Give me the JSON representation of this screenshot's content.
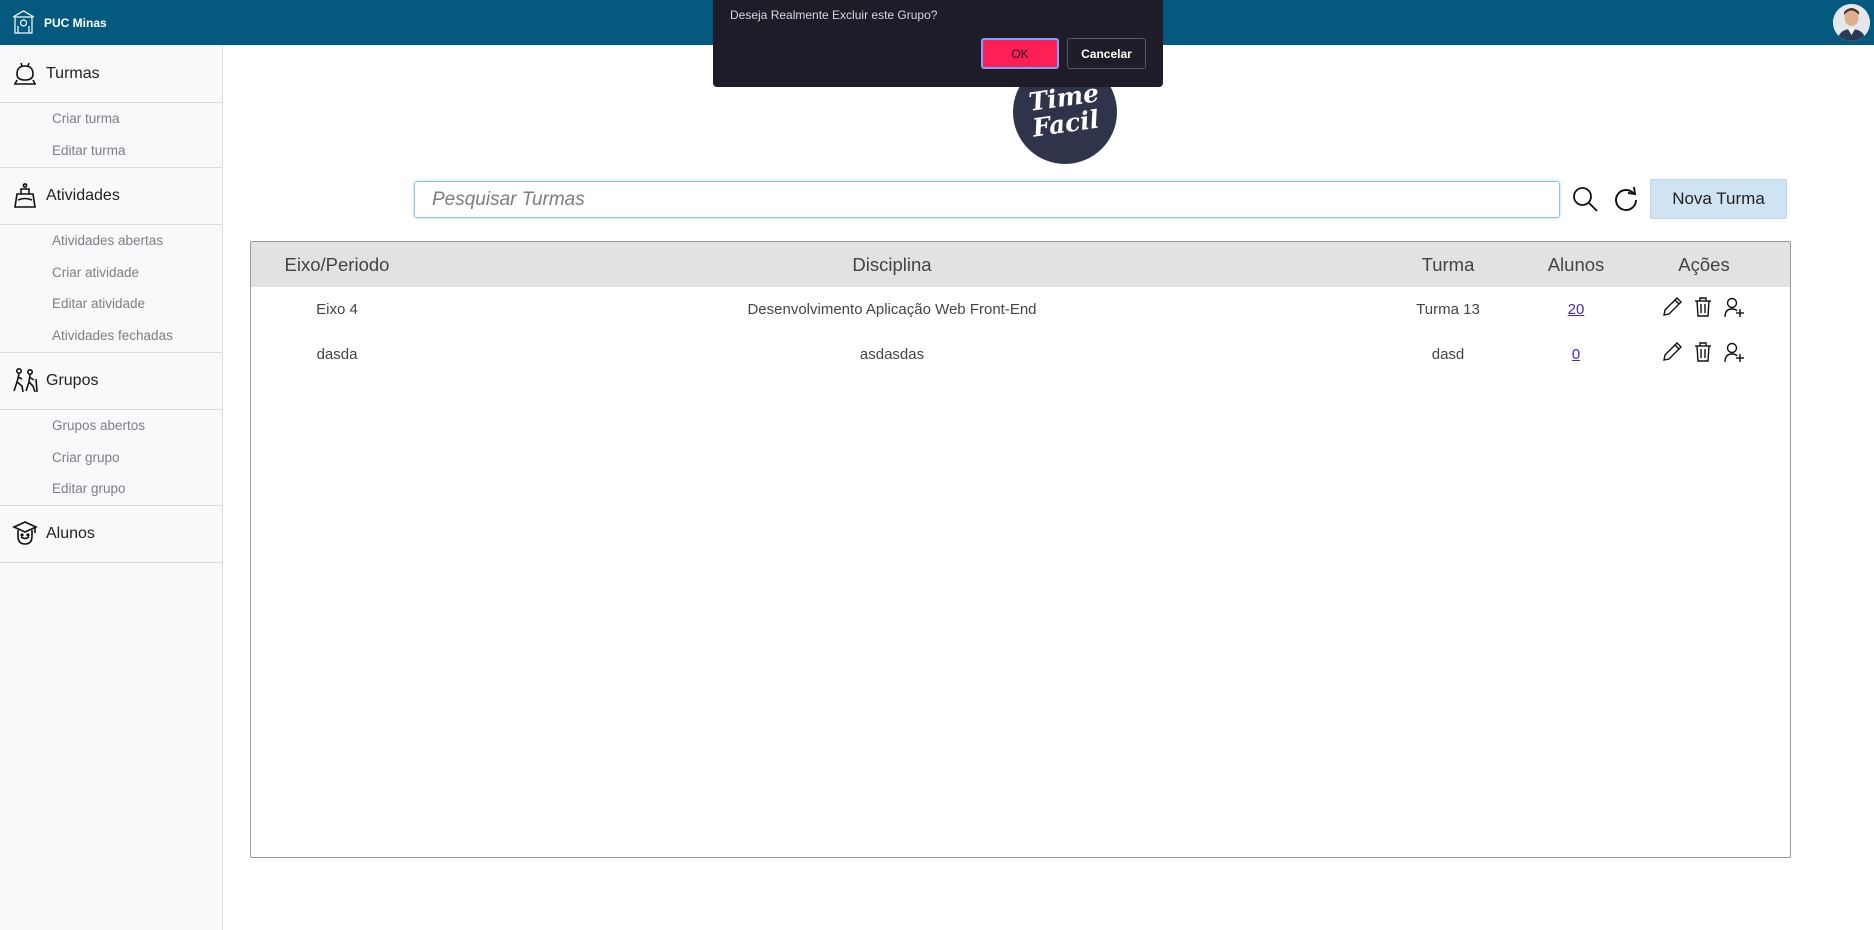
{
  "topbar": {
    "brand": "PUC Minas",
    "logo_icon": "puc-minas-crest-icon",
    "avatar_icon": "user-avatar-icon",
    "color": "#035a7e"
  },
  "sidebar": {
    "sections": [
      {
        "label": "Turmas",
        "icon": "class-icon",
        "items": [
          "Criar turma",
          "Editar turma"
        ]
      },
      {
        "label": "Atividades",
        "icon": "flask-icon",
        "items": [
          "Atividades abertas",
          "Criar atividade",
          "Editar atividade",
          "Atividades fechadas"
        ]
      },
      {
        "label": "Grupos",
        "icon": "group-hiking-icon",
        "items": [
          "Grupos abertos",
          "Criar grupo",
          "Editar grupo"
        ]
      },
      {
        "label": "Alunos",
        "icon": "student-icon",
        "items": []
      }
    ]
  },
  "app_logo": {
    "line1": "Time",
    "line2": "Facil"
  },
  "search": {
    "placeholder": "Pesquisar Turmas",
    "value": ""
  },
  "toolbar": {
    "search_icon": "search-icon",
    "refresh_icon": "refresh-icon",
    "new_label": "Nova Turma"
  },
  "table": {
    "headers": [
      "Eixo/Periodo",
      "Disciplina",
      "Turma",
      "Alunos",
      "Ações"
    ],
    "rows": [
      {
        "eixo": "Eixo 4",
        "disciplina": "Desenvolvimento Aplicação Web Front-End",
        "turma": "Turma 13",
        "alunos": "20"
      },
      {
        "eixo": "dasda",
        "disciplina": "asdasdas",
        "turma": "dasd",
        "alunos": "0"
      }
    ],
    "action_icons": [
      "edit-icon",
      "trash-icon",
      "add-user-icon"
    ]
  },
  "dialog": {
    "message": "Deseja Realmente Excluir este Grupo?",
    "ok_label": "OK",
    "cancel_label": "Cancelar",
    "ok_color": "#ff1f56"
  }
}
